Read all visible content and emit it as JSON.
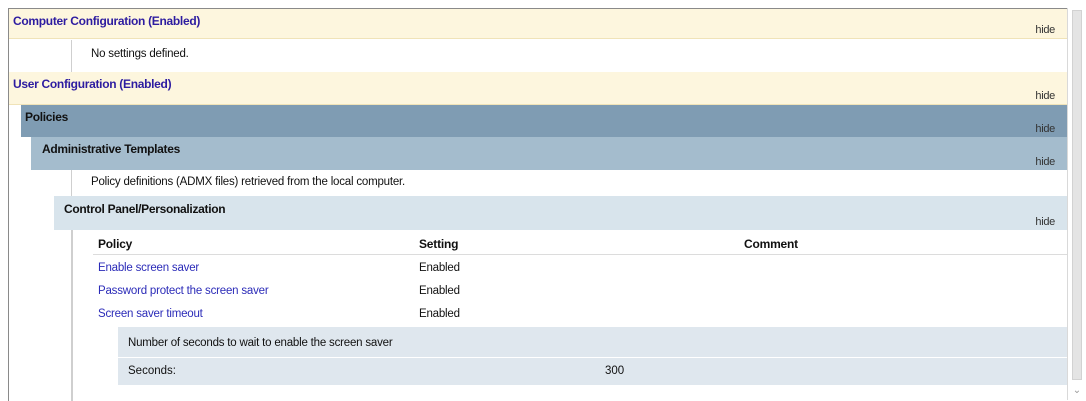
{
  "computer_config": {
    "title": "Computer Configuration (Enabled)",
    "hide": "hide",
    "note": "No settings defined."
  },
  "user_config": {
    "title": "User Configuration (Enabled)",
    "hide": "hide",
    "policies": {
      "title": "Policies",
      "hide": "hide",
      "admin_templates": {
        "title": "Administrative Templates",
        "hide": "hide",
        "note": "Policy definitions (ADMX files) retrieved from the local computer.",
        "control_panel": {
          "title": "Control Panel/Personalization",
          "hide": "hide",
          "table": {
            "headers": [
              "Policy",
              "Setting",
              "Comment"
            ],
            "rows": [
              {
                "policy": "Enable screen saver",
                "setting": "Enabled",
                "comment": ""
              },
              {
                "policy": "Password protect the screen saver",
                "setting": "Enabled",
                "comment": ""
              },
              {
                "policy": "Screen saver timeout",
                "setting": "Enabled",
                "comment": ""
              }
            ]
          },
          "detail": {
            "description": "Number of seconds to wait to enable the screen saver",
            "label": "Seconds:",
            "value": "300"
          }
        }
      }
    }
  },
  "colors": {
    "config_bg": "#fdf6de",
    "config_title": "#2d1ca0",
    "policies_bg": "#7f9cb3",
    "admin_bg": "#a4bccd",
    "control_bg": "#d8e4ec",
    "link": "#2b2bb8"
  }
}
